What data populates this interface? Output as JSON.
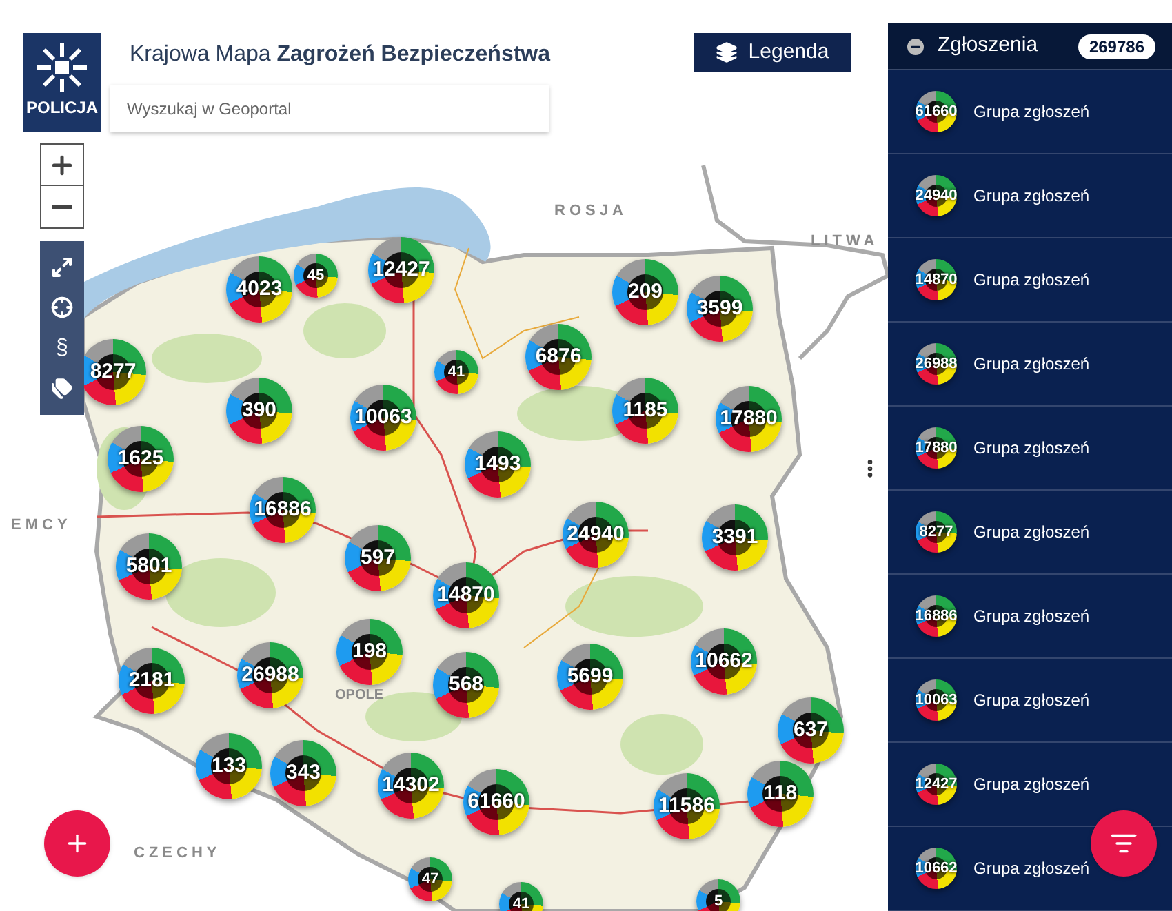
{
  "header": {
    "logo_text": "POLICJA",
    "title_light": "Krajowa Mapa",
    "title_bold": "Zagrożeń Bezpieczeństwa"
  },
  "search": {
    "placeholder": "Wyszukaj w Geoportal"
  },
  "legend_button": {
    "label": "Legenda"
  },
  "map_tools": [
    {
      "kind": "expand"
    },
    {
      "kind": "locate"
    },
    {
      "kind": "text",
      "text": "§"
    },
    {
      "kind": "tags"
    }
  ],
  "map_labels": [
    "ROSJA",
    "LITWA",
    "EMCY",
    "CZECHY",
    "OPOLE"
  ],
  "clusters": [
    {
      "count": "4023"
    },
    {
      "count": "45"
    },
    {
      "count": "12427"
    },
    {
      "count": "209"
    },
    {
      "count": "3599"
    },
    {
      "count": "8277"
    },
    {
      "count": "41"
    },
    {
      "count": "6876"
    },
    {
      "count": "390"
    },
    {
      "count": "10063"
    },
    {
      "count": "1185"
    },
    {
      "count": "17880"
    },
    {
      "count": "1625"
    },
    {
      "count": "1493"
    },
    {
      "count": "16886"
    },
    {
      "count": "24940"
    },
    {
      "count": "3391"
    },
    {
      "count": "5801"
    },
    {
      "count": "597"
    },
    {
      "count": "14870"
    },
    {
      "count": "198"
    },
    {
      "count": "2181"
    },
    {
      "count": "26988"
    },
    {
      "count": "568"
    },
    {
      "count": "5699"
    },
    {
      "count": "10662"
    },
    {
      "count": "637"
    },
    {
      "count": "133"
    },
    {
      "count": "343"
    },
    {
      "count": "14302"
    },
    {
      "count": "61660"
    },
    {
      "count": "11586"
    },
    {
      "count": "118"
    },
    {
      "count": "47"
    },
    {
      "count": "41"
    },
    {
      "count": "5"
    }
  ],
  "panel": {
    "title": "Zgłoszenia",
    "total": "269786",
    "items": [
      {
        "count": "61660",
        "label": "Grupa zgłoszeń"
      },
      {
        "count": "24940",
        "label": "Grupa zgłoszeń"
      },
      {
        "count": "14870",
        "label": "Grupa zgłoszeń"
      },
      {
        "count": "26988",
        "label": "Grupa zgłoszeń"
      },
      {
        "count": "17880",
        "label": "Grupa zgłoszeń"
      },
      {
        "count": "8277",
        "label": "Grupa zgłoszeń"
      },
      {
        "count": "16886",
        "label": "Grupa zgłoszeń"
      },
      {
        "count": "10063",
        "label": "Grupa zgłoszeń"
      },
      {
        "count": "12427",
        "label": "Grupa zgłoszeń"
      },
      {
        "count": "10662",
        "label": "Grupa zgłoszeń"
      }
    ]
  }
}
